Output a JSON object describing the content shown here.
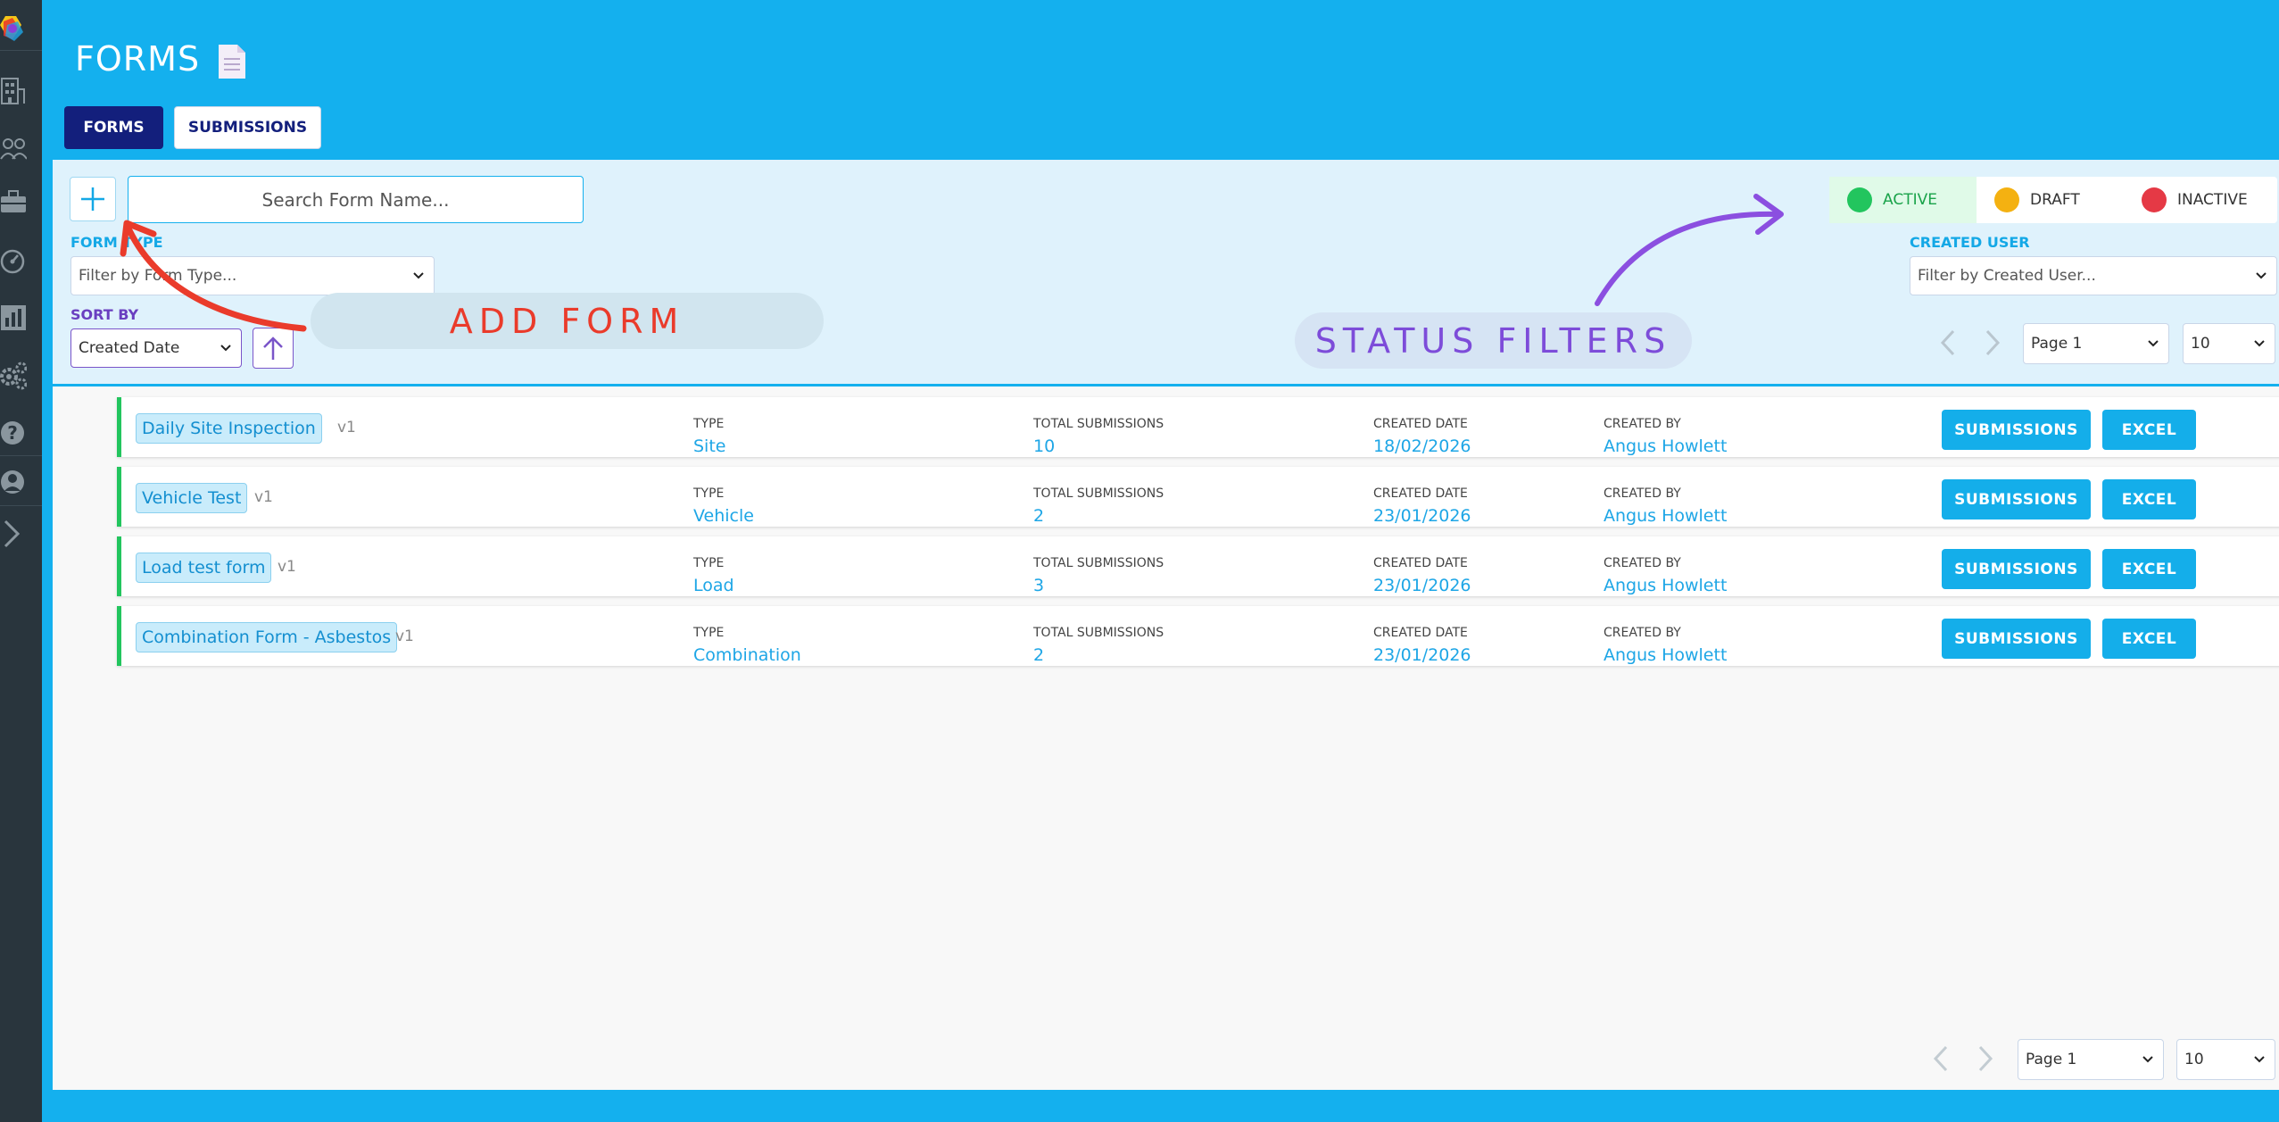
{
  "colors": {
    "brand": "#14b0ee",
    "navy": "#131f7c",
    "sidebar": "#29353d",
    "active": "#22c55e",
    "draft": "#f4b111",
    "inactive": "#e53945",
    "annotation_red": "#ea3b2b",
    "annotation_purple": "#7d4cd9"
  },
  "sidebar": {
    "items": [
      {
        "icon": "building-icon"
      },
      {
        "icon": "users-icon"
      },
      {
        "icon": "briefcase-icon"
      },
      {
        "icon": "gauge-icon"
      },
      {
        "icon": "bar-chart-icon"
      },
      {
        "icon": "gears-icon"
      },
      {
        "icon": "help-icon"
      },
      {
        "icon": "profile-icon"
      },
      {
        "icon": "chevron-right-icon"
      }
    ]
  },
  "header": {
    "title": "FORMS",
    "title_icon": "document-icon"
  },
  "tabs": [
    {
      "label": "FORMS",
      "active": true
    },
    {
      "label": "SUBMISSIONS",
      "active": false
    }
  ],
  "filters": {
    "search_placeholder": "Search Form Name...",
    "form_type_label": "FORM TYPE",
    "form_type_placeholder": "Filter by Form Type...",
    "created_user_label": "CREATED USER",
    "created_user_placeholder": "Filter by Created User...",
    "sort_label": "SORT BY",
    "sort_value": "Created Date"
  },
  "status": [
    {
      "label": "ACTIVE",
      "color": "#22c55e"
    },
    {
      "label": "DRAFT",
      "color": "#f4b111"
    },
    {
      "label": "INACTIVE",
      "color": "#e53945"
    }
  ],
  "pagination": {
    "page": "Page 1",
    "per_page": "10"
  },
  "annotations": {
    "add_form": "ADD FORM",
    "status_filters": "STATUS FILTERS"
  },
  "columns": {
    "type": "TYPE",
    "total": "TOTAL SUBMISSIONS",
    "created_date": "CREATED DATE",
    "created_by": "CREATED BY"
  },
  "row_buttons": {
    "submissions": "SUBMISSIONS",
    "excel": "EXCEL"
  },
  "forms": [
    {
      "name": "Daily Site Inspection",
      "version": "v1",
      "type": "Site",
      "total": "10",
      "date": "18/02/2026",
      "by": "Angus Howlett"
    },
    {
      "name": "Vehicle Test",
      "version": "v1",
      "type": "Vehicle",
      "total": "2",
      "date": "23/01/2026",
      "by": "Angus Howlett"
    },
    {
      "name": "Load test form",
      "version": "v1",
      "type": "Load",
      "total": "3",
      "date": "23/01/2026",
      "by": "Angus Howlett"
    },
    {
      "name": "Combination Form - Asbestos",
      "version": "v1",
      "type": "Combination",
      "total": "2",
      "date": "23/01/2026",
      "by": "Angus Howlett"
    }
  ]
}
